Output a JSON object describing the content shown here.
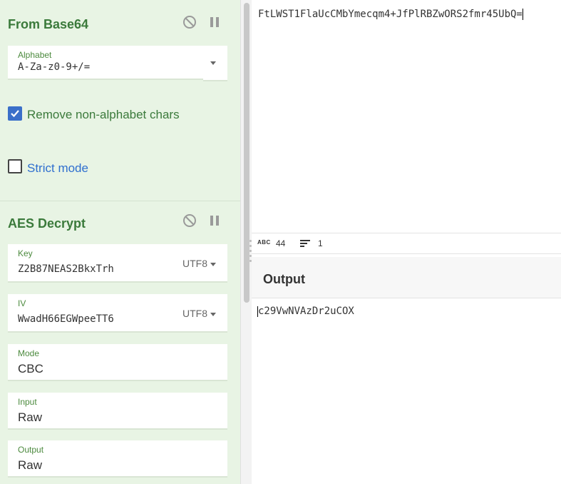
{
  "recipe": {
    "from_base64": {
      "title": "From Base64",
      "alphabet_label": "Alphabet",
      "alphabet_value": "A-Za-z0-9+/=",
      "remove_non_alphabet_label": "Remove non-alphabet chars",
      "remove_non_alphabet_checked": true,
      "strict_mode_label": "Strict mode",
      "strict_mode_checked": false
    },
    "aes_decrypt": {
      "title": "AES Decrypt",
      "key_label": "Key",
      "key_value": "Z2B87NEAS2BkxTrh",
      "key_encoding": "UTF8",
      "iv_label": "IV",
      "iv_value": "WwadH66EGWpeeTT6",
      "iv_encoding": "UTF8",
      "mode_label": "Mode",
      "mode_value": "CBC",
      "input_label": "Input",
      "input_value": "Raw",
      "output_label": "Output",
      "output_value": "Raw"
    }
  },
  "input": {
    "text": "FtLWST1FlaUcCMbYmecqm4+JfPlRBZwORS2fmr45UbQ="
  },
  "status": {
    "abc_badge": "ABC",
    "length": "44",
    "lines": "1"
  },
  "output": {
    "title": "Output",
    "text": "c29VwNVAzDr2uCOX"
  },
  "colors": {
    "panel_bg": "#e8f4e4",
    "title_green": "#3b7a3b",
    "checkbox_blue": "#3a6fc9",
    "link_blue": "#2f6fcf"
  }
}
